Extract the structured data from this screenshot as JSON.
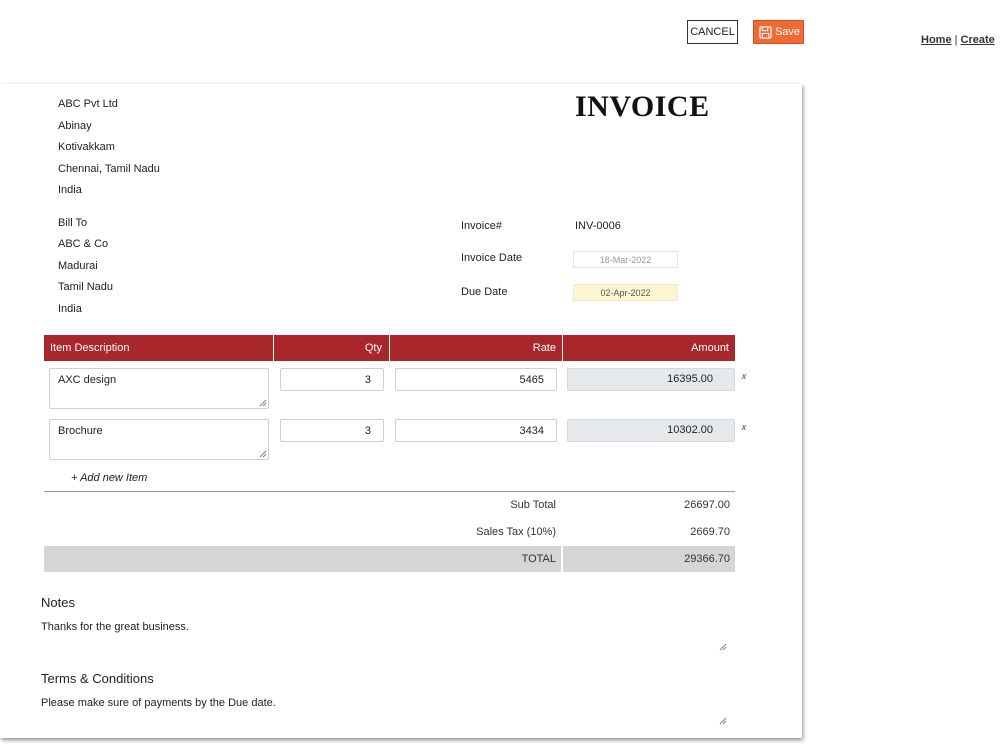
{
  "toolbar": {
    "cancel_label": "CANCEL",
    "save_label": "Save",
    "save_color": "#ef6a35",
    "links": [
      "Home",
      "Create"
    ],
    "link_separator": "|"
  },
  "company": {
    "lines": [
      "ABC Pvt Ltd",
      "Abinay",
      "Kotivakkam",
      "Chennai, Tamil Nadu",
      "India"
    ]
  },
  "title": "INVOICE",
  "bill_to": {
    "lines": [
      "Bill To",
      "ABC & Co",
      "Madurai",
      "Tamil Nadu",
      "India"
    ]
  },
  "meta": {
    "invoice_number_label": "Invoice#",
    "invoice_number": "INV-0006",
    "invoice_date_label": "Invoice Date",
    "invoice_date": "18-Mar-2022",
    "due_date_label": "Due Date",
    "due_date": "02-Apr-2022"
  },
  "table": {
    "header_color": "#a9262a",
    "columns": [
      "Item Description",
      "Qty",
      "Rate",
      "Amount"
    ],
    "rows": [
      {
        "description": "AXC design",
        "qty": "3",
        "rate": "5465",
        "amount": "16395.00",
        "remove": "x"
      },
      {
        "description": "Brochure",
        "qty": "3",
        "rate": "3434",
        "amount": "10302.00",
        "remove": "x"
      }
    ],
    "add_item_label": "+ Add new Item"
  },
  "summary": {
    "subtotal_label": "Sub Total",
    "subtotal": "26697.00",
    "tax_label": "Sales Tax (10%)",
    "tax": "2669.70",
    "total_label": "TOTAL",
    "total": "29366.70"
  },
  "notes": {
    "title": "Notes",
    "text": "Thanks for the great business."
  },
  "terms": {
    "title": "Terms & Conditions",
    "text": "Please make sure of payments by the Due date."
  }
}
